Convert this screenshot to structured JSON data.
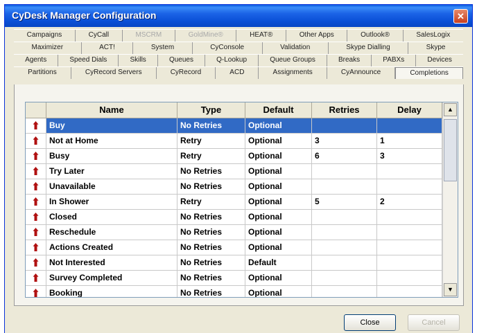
{
  "window": {
    "title": "CyDesk Manager Configuration"
  },
  "tabs": {
    "row1": [
      {
        "label": "Campaigns",
        "disabled": false
      },
      {
        "label": "CyCall",
        "disabled": false
      },
      {
        "label": "MSCRM",
        "disabled": true
      },
      {
        "label": "GoldMine®",
        "disabled": true
      },
      {
        "label": "HEAT®",
        "disabled": false
      },
      {
        "label": "Other Apps",
        "disabled": false
      },
      {
        "label": "Outlook®",
        "disabled": false
      },
      {
        "label": "SalesLogix",
        "disabled": false
      }
    ],
    "row2": [
      {
        "label": "Maximizer"
      },
      {
        "label": "ACT!"
      },
      {
        "label": "System"
      },
      {
        "label": "CyConsole"
      },
      {
        "label": "Validation"
      },
      {
        "label": "Skype Dialling"
      },
      {
        "label": "Skype"
      }
    ],
    "row3": [
      {
        "label": "Agents"
      },
      {
        "label": "Speed Dials"
      },
      {
        "label": "Skills"
      },
      {
        "label": "Queues"
      },
      {
        "label": "Q-Lookup"
      },
      {
        "label": "Queue Groups"
      },
      {
        "label": "Breaks"
      },
      {
        "label": "PABXs"
      },
      {
        "label": "Devices"
      }
    ],
    "row4": [
      {
        "label": "Partitions"
      },
      {
        "label": "CyRecord Servers"
      },
      {
        "label": "CyRecord"
      },
      {
        "label": "ACD"
      },
      {
        "label": "Assignments"
      },
      {
        "label": "CyAnnounce"
      },
      {
        "label": "Completions",
        "active": true
      }
    ]
  },
  "grid": {
    "columns": [
      "",
      "Name",
      "Type",
      "Default",
      "Retries",
      "Delay"
    ],
    "rows": [
      {
        "name": "Buy",
        "type": "No Retries",
        "default": "Optional",
        "retries": "",
        "delay": "",
        "selected": true
      },
      {
        "name": "Not at Home",
        "type": "Retry",
        "default": "Optional",
        "retries": "3",
        "delay": "1"
      },
      {
        "name": "Busy",
        "type": "Retry",
        "default": "Optional",
        "retries": "6",
        "delay": "3"
      },
      {
        "name": "Try Later",
        "type": "No Retries",
        "default": "Optional",
        "retries": "",
        "delay": ""
      },
      {
        "name": "Unavailable",
        "type": "No Retries",
        "default": "Optional",
        "retries": "",
        "delay": ""
      },
      {
        "name": "In Shower",
        "type": "Retry",
        "default": "Optional",
        "retries": "5",
        "delay": "2"
      },
      {
        "name": "Closed",
        "type": "No Retries",
        "default": "Optional",
        "retries": "",
        "delay": ""
      },
      {
        "name": "Reschedule",
        "type": "No Retries",
        "default": "Optional",
        "retries": "",
        "delay": ""
      },
      {
        "name": "Actions Created",
        "type": "No Retries",
        "default": "Optional",
        "retries": "",
        "delay": ""
      },
      {
        "name": "Not Interested",
        "type": "No Retries",
        "default": "Default",
        "retries": "",
        "delay": ""
      },
      {
        "name": "Survey Completed",
        "type": "No Retries",
        "default": "Optional",
        "retries": "",
        "delay": ""
      },
      {
        "name": "Booking",
        "type": "No Retries",
        "default": "Optional",
        "retries": "",
        "delay": ""
      }
    ]
  },
  "buttons": {
    "close": "Close",
    "cancel": "Cancel"
  },
  "icons": {
    "window_close": "close-icon",
    "row": "red-arrow-up-icon",
    "scroll_up": "▲",
    "scroll_down": "▼"
  },
  "colors": {
    "title_bar": "#0a4fd6",
    "selection": "#316ac5",
    "row_icon": "#b01010"
  }
}
